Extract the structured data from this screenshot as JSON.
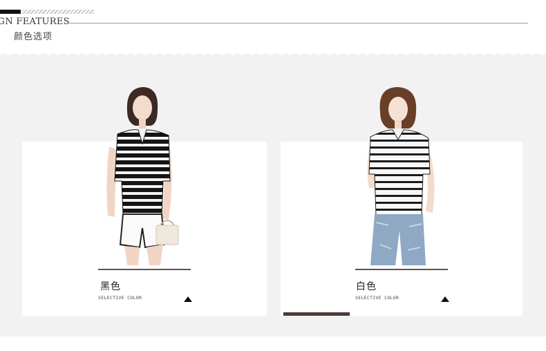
{
  "header": {
    "title": "SIGN FEATURES",
    "subtitle": "颜色选项"
  },
  "colors": {
    "band": "#f2f2f2",
    "card": "#ffffff",
    "progress": "#4b3a36"
  },
  "products": [
    {
      "name": "黑色",
      "caption": "SELECTIVE COLOR",
      "icon": "triangle-up-icon"
    },
    {
      "name": "白色",
      "caption": "SELECTIVE COLOR",
      "icon": "triangle-up-icon"
    }
  ]
}
